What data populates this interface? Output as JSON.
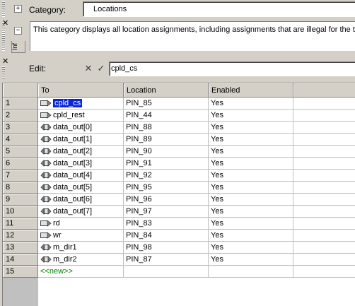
{
  "category_bar": {
    "label": "Category:",
    "value": "Locations"
  },
  "description": {
    "text": "This category displays all location assignments, including assignments that are illegal for the tar",
    "side_tab_label": "Inf"
  },
  "edit_bar": {
    "label": "Edit:",
    "value": "cpld_cs"
  },
  "grid": {
    "columns": [
      "To",
      "Location",
      "Enabled"
    ],
    "rows": [
      {
        "num": "1",
        "to": "cpld_cs",
        "icon": "input-pin-icon",
        "location": "PIN_85",
        "enabled": "Yes",
        "selected": true
      },
      {
        "num": "2",
        "to": "cpld_rest",
        "icon": "input-pin-icon",
        "location": "PIN_44",
        "enabled": "Yes"
      },
      {
        "num": "3",
        "to": "data_out[0]",
        "icon": "bidir-pin-icon",
        "location": "PIN_88",
        "enabled": "Yes"
      },
      {
        "num": "4",
        "to": "data_out[1]",
        "icon": "bidir-pin-icon",
        "location": "PIN_89",
        "enabled": "Yes"
      },
      {
        "num": "5",
        "to": "data_out[2]",
        "icon": "bidir-pin-icon",
        "location": "PIN_90",
        "enabled": "Yes"
      },
      {
        "num": "6",
        "to": "data_out[3]",
        "icon": "bidir-pin-icon",
        "location": "PIN_91",
        "enabled": "Yes"
      },
      {
        "num": "7",
        "to": "data_out[4]",
        "icon": "bidir-pin-icon",
        "location": "PIN_92",
        "enabled": "Yes"
      },
      {
        "num": "8",
        "to": "data_out[5]",
        "icon": "bidir-pin-icon",
        "location": "PIN_95",
        "enabled": "Yes"
      },
      {
        "num": "9",
        "to": "data_out[6]",
        "icon": "bidir-pin-icon",
        "location": "PIN_96",
        "enabled": "Yes"
      },
      {
        "num": "10",
        "to": "data_out[7]",
        "icon": "bidir-pin-icon",
        "location": "PIN_97",
        "enabled": "Yes"
      },
      {
        "num": "11",
        "to": "rd",
        "icon": "input-pin-icon",
        "location": "PIN_83",
        "enabled": "Yes"
      },
      {
        "num": "12",
        "to": "wr",
        "icon": "input-pin-icon",
        "location": "PIN_84",
        "enabled": "Yes"
      },
      {
        "num": "13",
        "to": "m_dir1",
        "icon": "bidir-pin-icon",
        "location": "PIN_98",
        "enabled": "Yes"
      },
      {
        "num": "14",
        "to": "m_dir2",
        "icon": "bidir-pin-icon",
        "location": "PIN_87",
        "enabled": "Yes"
      },
      {
        "num": "15",
        "to": "<<new>>",
        "icon": "",
        "location": "",
        "enabled": "",
        "new_row": true
      }
    ]
  },
  "colors": {
    "selection": "#0a24d6",
    "new_row_text": "#008000",
    "chrome": "#d4d0c8"
  }
}
